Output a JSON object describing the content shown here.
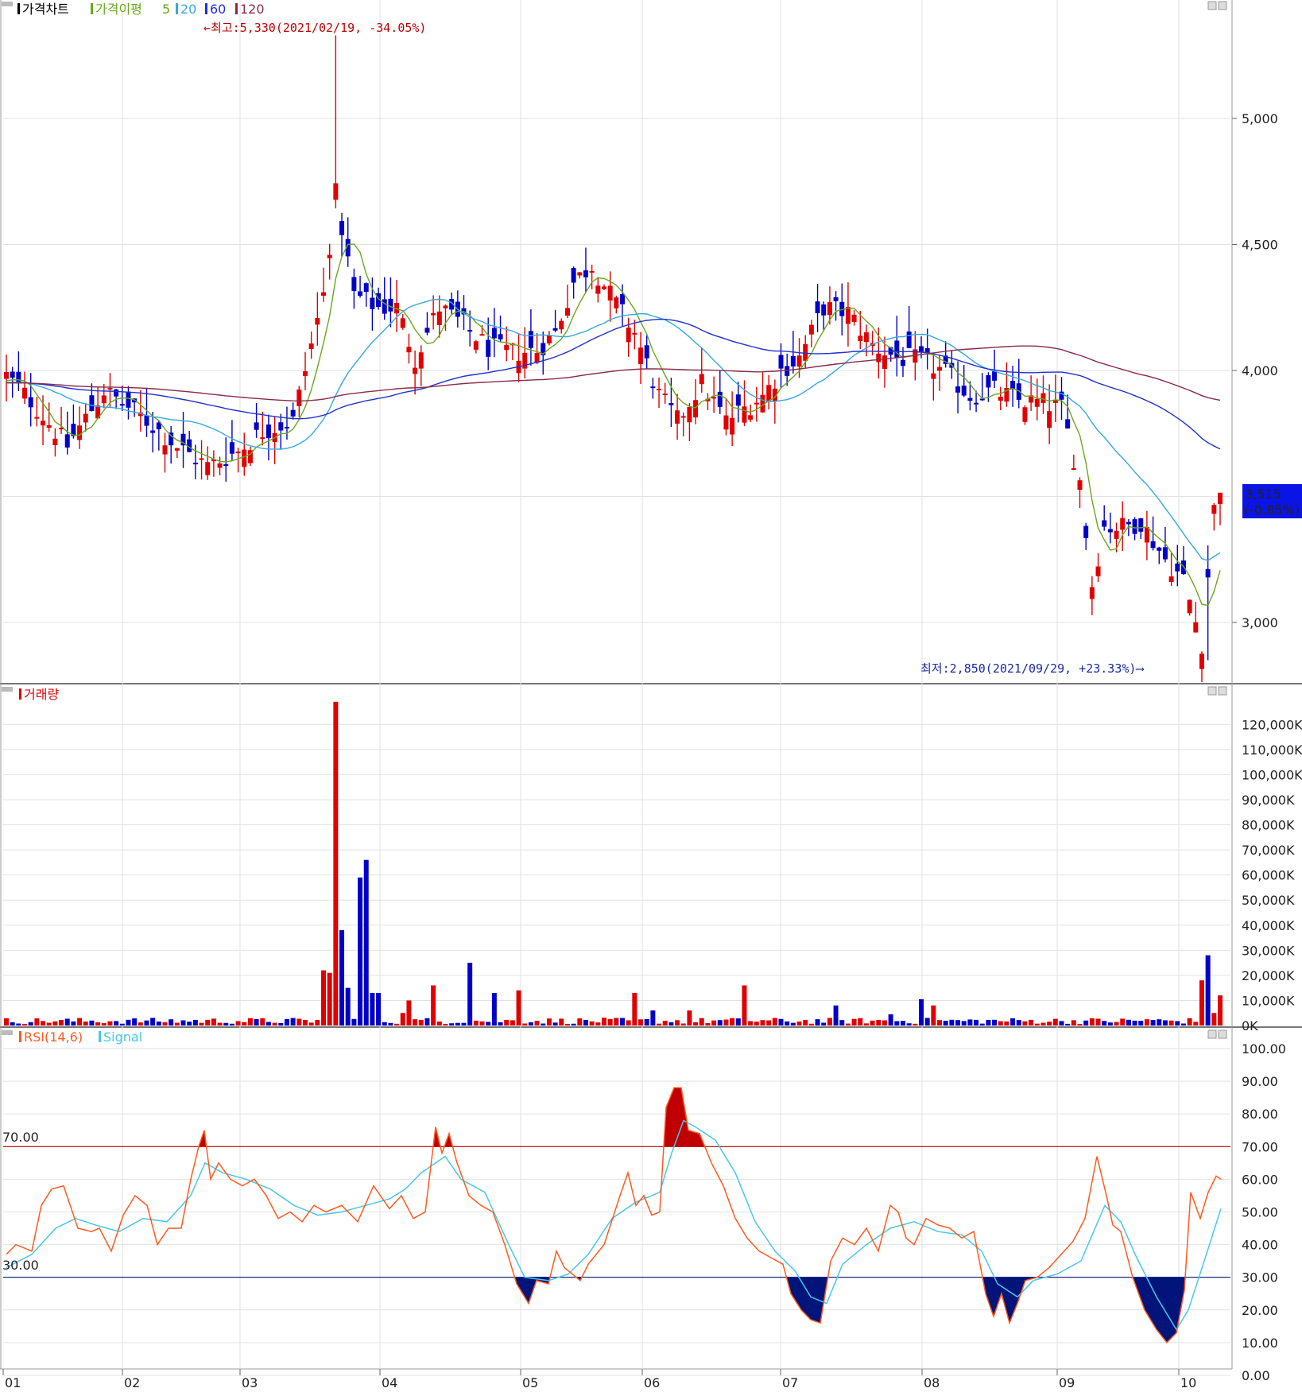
{
  "colors": {
    "up": "#e00000",
    "down": "#0000c8",
    "ma5": "#6aa81e",
    "ma20": "#36a8e0",
    "ma60": "#2030d0",
    "ma120": "#8a2a4a",
    "rsi": "#ff5a1e",
    "signal": "#48c8e8",
    "grid": "#e2e2e2",
    "axis": "#888888",
    "overbought": "#c00000",
    "oversold": "#00147a"
  },
  "price_panel": {
    "legend": {
      "series_label": "가격차트",
      "ma_label": "가격이평",
      "ma5": "5",
      "ma20": "20",
      "ma60": "60",
      "ma120": "120"
    },
    "high_annotation": "←최고:5,330(2021/02/19, -34.05%)",
    "low_annotation": "최저:2,850(2021/09/29, +23.33%)⟶",
    "current_price": "3,515",
    "current_change": "(-0.85%)",
    "yticks": [
      "5,000",
      "4,500",
      "4,000",
      "3,000"
    ]
  },
  "volume_panel": {
    "legend": "거래량",
    "yticks": [
      "120,000K",
      "110,000K",
      "100,000K",
      "90,000K",
      "80,000K",
      "70,000K",
      "60,000K",
      "50,000K",
      "40,000K",
      "30,000K",
      "20,000K",
      "10,000K",
      "0K"
    ]
  },
  "rsi_panel": {
    "legend_rsi": "RSI(14,6)",
    "legend_signal": "Signal",
    "level_high": "70.00",
    "level_low": "30.00",
    "yticks": [
      "100.00",
      "90.00",
      "80.00",
      "70.00",
      "60.00",
      "50.00",
      "40.00",
      "30.00",
      "20.00",
      "10.00",
      "0.00"
    ]
  },
  "x_axis": {
    "months": [
      "01",
      "02",
      "03",
      "04",
      "05",
      "06",
      "07",
      "08",
      "09",
      "10"
    ]
  },
  "chart_data": [
    {
      "type": "candlestick",
      "title": "가격차트",
      "ylim": [
        2750,
        5330
      ],
      "high": {
        "value": 5330,
        "date": "2021/02/19"
      },
      "low": {
        "value": 2850,
        "date": "2021/09/29"
      },
      "last": {
        "value": 3515,
        "change_pct": -0.85
      },
      "ma_periods": [
        5,
        20,
        60,
        120
      ],
      "close_trajectory": [
        {
          "month": "01",
          "close": 3950
        },
        {
          "month": "02",
          "close": 3640
        },
        {
          "month": "02-19",
          "close": 4700
        },
        {
          "month": "03",
          "close": 4150
        },
        {
          "month": "04",
          "close": 4180
        },
        {
          "month": "04-mid",
          "close": 4420
        },
        {
          "month": "05",
          "close": 3800
        },
        {
          "month": "06",
          "close": 4250
        },
        {
          "month": "07",
          "close": 4050
        },
        {
          "month": "08",
          "close": 3900
        },
        {
          "month": "08-mid",
          "close": 3150
        },
        {
          "month": "09",
          "close": 3400
        },
        {
          "month": "09-29",
          "close": 2900
        },
        {
          "month": "10",
          "close": 3515
        }
      ]
    },
    {
      "type": "bar",
      "title": "거래량",
      "ylim": [
        0,
        130000
      ],
      "unit": "K",
      "peaks": [
        {
          "month": "02-19",
          "value": 129000
        },
        {
          "month": "02-26",
          "value": 66000
        },
        {
          "month": "10-05",
          "value": 28000
        },
        {
          "month": "03-10",
          "value": 25000
        }
      ]
    },
    {
      "type": "line",
      "title": "RSI(14,6)",
      "ylim": [
        0,
        100
      ],
      "levels": [
        70,
        30
      ],
      "series": [
        {
          "name": "RSI(14,6)",
          "key_points": [
            {
              "month": "02-19",
              "value": 75
            },
            {
              "month": "06-03",
              "value": 88
            },
            {
              "month": "05-01",
              "value": 22
            },
            {
              "month": "07-05",
              "value": 17
            },
            {
              "month": "08-10",
              "value": 15
            },
            {
              "month": "09-29",
              "value": 9
            },
            {
              "month": "10-10",
              "value": 61
            }
          ]
        },
        {
          "name": "Signal"
        }
      ]
    }
  ]
}
